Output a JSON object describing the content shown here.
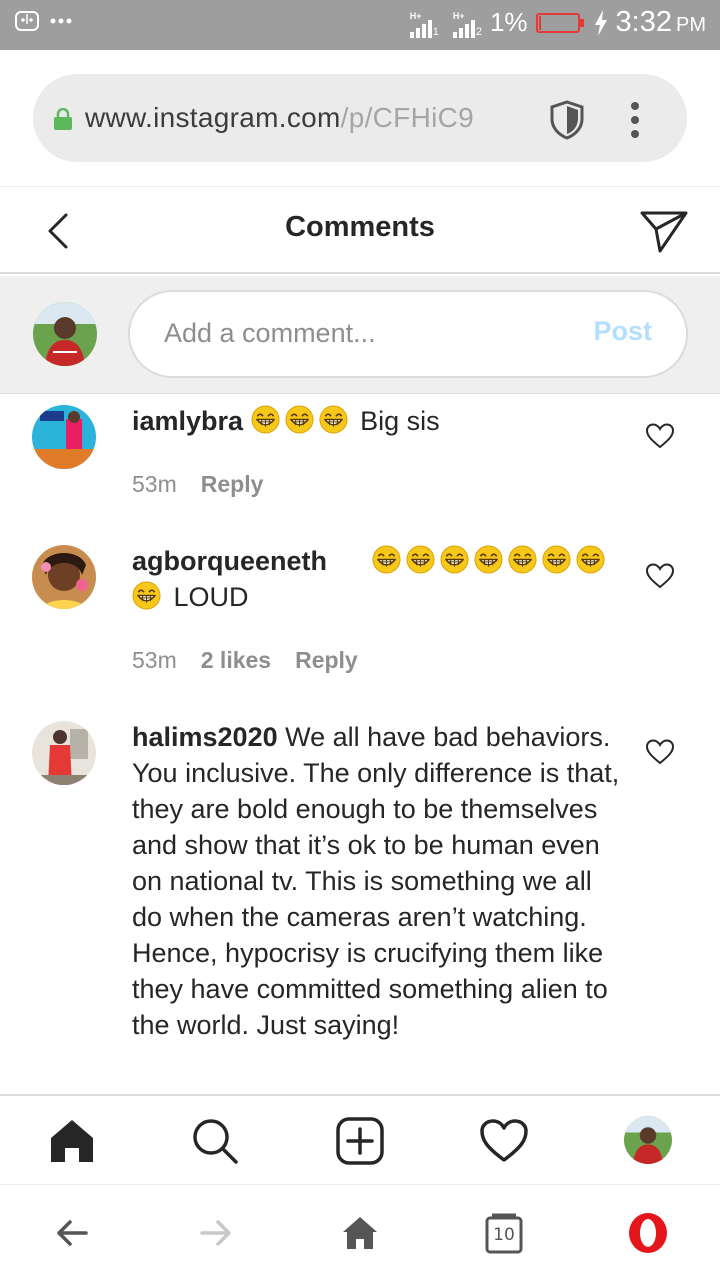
{
  "status_bar": {
    "network_1": "H+",
    "network_2": "H+",
    "sim_1": "1",
    "sim_2": "2",
    "battery_percent": "1%",
    "battery_level": 0.01,
    "time": "3:32",
    "ampm": "PM",
    "icons": [
      "face-icon",
      "more-notifications-icon",
      "signal-icon",
      "battery-icon",
      "charging-icon"
    ]
  },
  "browser": {
    "url_host": "www.instagram.com",
    "url_path": "/p/CFHiC9",
    "tabs_count": "10"
  },
  "header": {
    "title": "Comments"
  },
  "composer": {
    "placeholder": "Add a comment...",
    "post_label": "Post"
  },
  "comments": [
    {
      "username": "iamlybra",
      "text": "Big sis",
      "emoji_count": 3,
      "time": "53m",
      "likes": "",
      "reply_label": "Reply"
    },
    {
      "username": "agborqueeneth",
      "text": "LOUD",
      "emoji_count": 8,
      "time": "53m",
      "likes": "2 likes",
      "reply_label": "Reply"
    },
    {
      "username": "halims2020",
      "text": "We all have bad behaviors. You inclusive. The only difference is that, they are bold enough to be themselves and show that it’s ok to be human even on national tv. This is something we all do when the cameras aren’t watching. Hence, hypocrisy is crucifying them like they have committed something alien to the world. Just saying!",
      "time": "",
      "likes": "",
      "reply_label": ""
    }
  ],
  "colors": {
    "status_bar": "#9e9e9e",
    "post_disabled": "#b2dffc",
    "secure_lock": "#5cb85c",
    "opera_red": "#e4161b",
    "battery_low": "#e53935"
  }
}
